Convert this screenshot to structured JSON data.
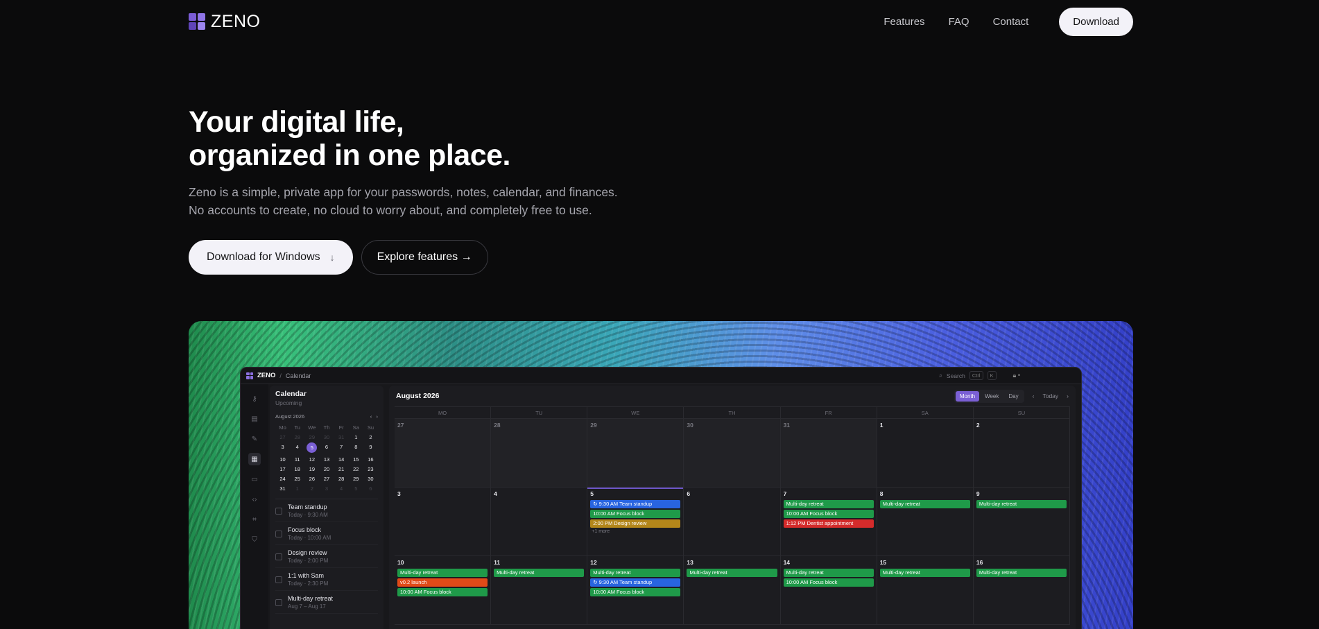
{
  "brand": {
    "name": "ZENO"
  },
  "nav": {
    "links": [
      "Features",
      "FAQ",
      "Contact"
    ],
    "download_label": "Download"
  },
  "hero": {
    "title_line1": "Your digital life,",
    "title_line2": "organized in one place.",
    "description": "Zeno is a simple, private app for your passwords, notes, calendar, and finances. No accounts to create, no cloud to worry about, and completely free to use.",
    "primary_cta": "Download for Windows",
    "primary_cta_icon": "↓",
    "secondary_cta": "Explore features →"
  },
  "app": {
    "name": "ZENO",
    "breadcrumb_sep": "/",
    "breadcrumb": "Calendar",
    "search_placeholder": "Search",
    "search_shortcut": "Ctrl",
    "search_shortcut_key": "K",
    "sidebar": {
      "title": "Calendar",
      "subtitle": "Upcoming",
      "mini_month": "August 2026",
      "mini_prev": "‹",
      "mini_next": "›",
      "weekdays": [
        "Mo",
        "Tu",
        "We",
        "Th",
        "Fr",
        "Sa",
        "Su"
      ],
      "days": [
        [
          "27",
          "28",
          "29",
          "30",
          "31",
          "1",
          "2"
        ],
        [
          "3",
          "4",
          "5",
          "6",
          "7",
          "8",
          "9"
        ],
        [
          "10",
          "11",
          "12",
          "13",
          "14",
          "15",
          "16"
        ],
        [
          "17",
          "18",
          "19",
          "20",
          "21",
          "22",
          "23"
        ],
        [
          "24",
          "25",
          "26",
          "27",
          "28",
          "29",
          "30"
        ],
        [
          "31",
          "1",
          "2",
          "3",
          "4",
          "5",
          "6"
        ]
      ],
      "today": "5",
      "upcoming": [
        {
          "title": "Team standup",
          "time": "Today · 9:30 AM"
        },
        {
          "title": "Focus block",
          "time": "Today · 10:00 AM"
        },
        {
          "title": "Design review",
          "time": "Today · 2:00 PM"
        },
        {
          "title": "1:1 with Sam",
          "time": "Today · 2:30 PM"
        },
        {
          "title": "Multi-day retreat",
          "time": "Aug 7 – Aug 17"
        }
      ]
    },
    "calendar": {
      "title": "August 2026",
      "views": [
        "Month",
        "Week",
        "Day"
      ],
      "active_view": "Month",
      "today_label": "Today",
      "prev": "‹",
      "next": "›",
      "weekdays": [
        "MO",
        "TU",
        "WE",
        "TH",
        "FR",
        "SA",
        "SU"
      ],
      "weeks": [
        [
          {
            "num": "27",
            "off": true,
            "events": []
          },
          {
            "num": "28",
            "off": true,
            "events": []
          },
          {
            "num": "29",
            "off": true,
            "events": []
          },
          {
            "num": "30",
            "off": true,
            "events": []
          },
          {
            "num": "31",
            "off": true,
            "events": []
          },
          {
            "num": "1",
            "events": []
          },
          {
            "num": "2",
            "events": []
          }
        ],
        [
          {
            "num": "3",
            "events": []
          },
          {
            "num": "4",
            "events": []
          },
          {
            "num": "5",
            "selected": true,
            "events": [
              {
                "label": "↻ 9:30 AM Team standup",
                "color": "blue"
              },
              {
                "label": "10:00 AM Focus block",
                "color": "green"
              },
              {
                "label": "2:00 PM Design review",
                "color": "orange"
              }
            ],
            "more": "+1 more"
          },
          {
            "num": "6",
            "events": []
          },
          {
            "num": "7",
            "events": [
              {
                "label": "Multi-day retreat",
                "color": "green"
              },
              {
                "label": "10:00 AM Focus block",
                "color": "green"
              },
              {
                "label": "1:12 PM Dentist appointment",
                "color": "red"
              }
            ]
          },
          {
            "num": "8",
            "events": [
              {
                "label": "Multi-day retreat",
                "color": "green"
              }
            ]
          },
          {
            "num": "9",
            "events": [
              {
                "label": "Multi-day retreat",
                "color": "green"
              }
            ]
          }
        ],
        [
          {
            "num": "10",
            "events": [
              {
                "label": "Multi-day retreat",
                "color": "green"
              },
              {
                "label": "v0.2 launch",
                "color": "vermilion"
              },
              {
                "label": "10:00 AM Focus block",
                "color": "green"
              }
            ]
          },
          {
            "num": "11",
            "events": [
              {
                "label": "Multi-day retreat",
                "color": "green"
              }
            ]
          },
          {
            "num": "12",
            "events": [
              {
                "label": "Multi-day retreat",
                "color": "green"
              },
              {
                "label": "↻ 9:30 AM Team standup",
                "color": "blue"
              },
              {
                "label": "10:00 AM Focus block",
                "color": "green"
              }
            ]
          },
          {
            "num": "13",
            "events": [
              {
                "label": "Multi-day retreat",
                "color": "green"
              }
            ]
          },
          {
            "num": "14",
            "events": [
              {
                "label": "Multi-day retreat",
                "color": "green"
              },
              {
                "label": "10:00 AM Focus block",
                "color": "green"
              }
            ]
          },
          {
            "num": "15",
            "events": [
              {
                "label": "Multi-day retreat",
                "color": "green"
              }
            ]
          },
          {
            "num": "16",
            "events": [
              {
                "label": "Multi-day retreat",
                "color": "green"
              }
            ]
          }
        ]
      ]
    }
  },
  "colors": {
    "accent": "#7a5fd4",
    "background": "#0b0b0c",
    "event_green": "#1f9a49",
    "event_blue": "#2864e0",
    "event_orange": "#b3861a",
    "event_red": "#d42b2b"
  }
}
